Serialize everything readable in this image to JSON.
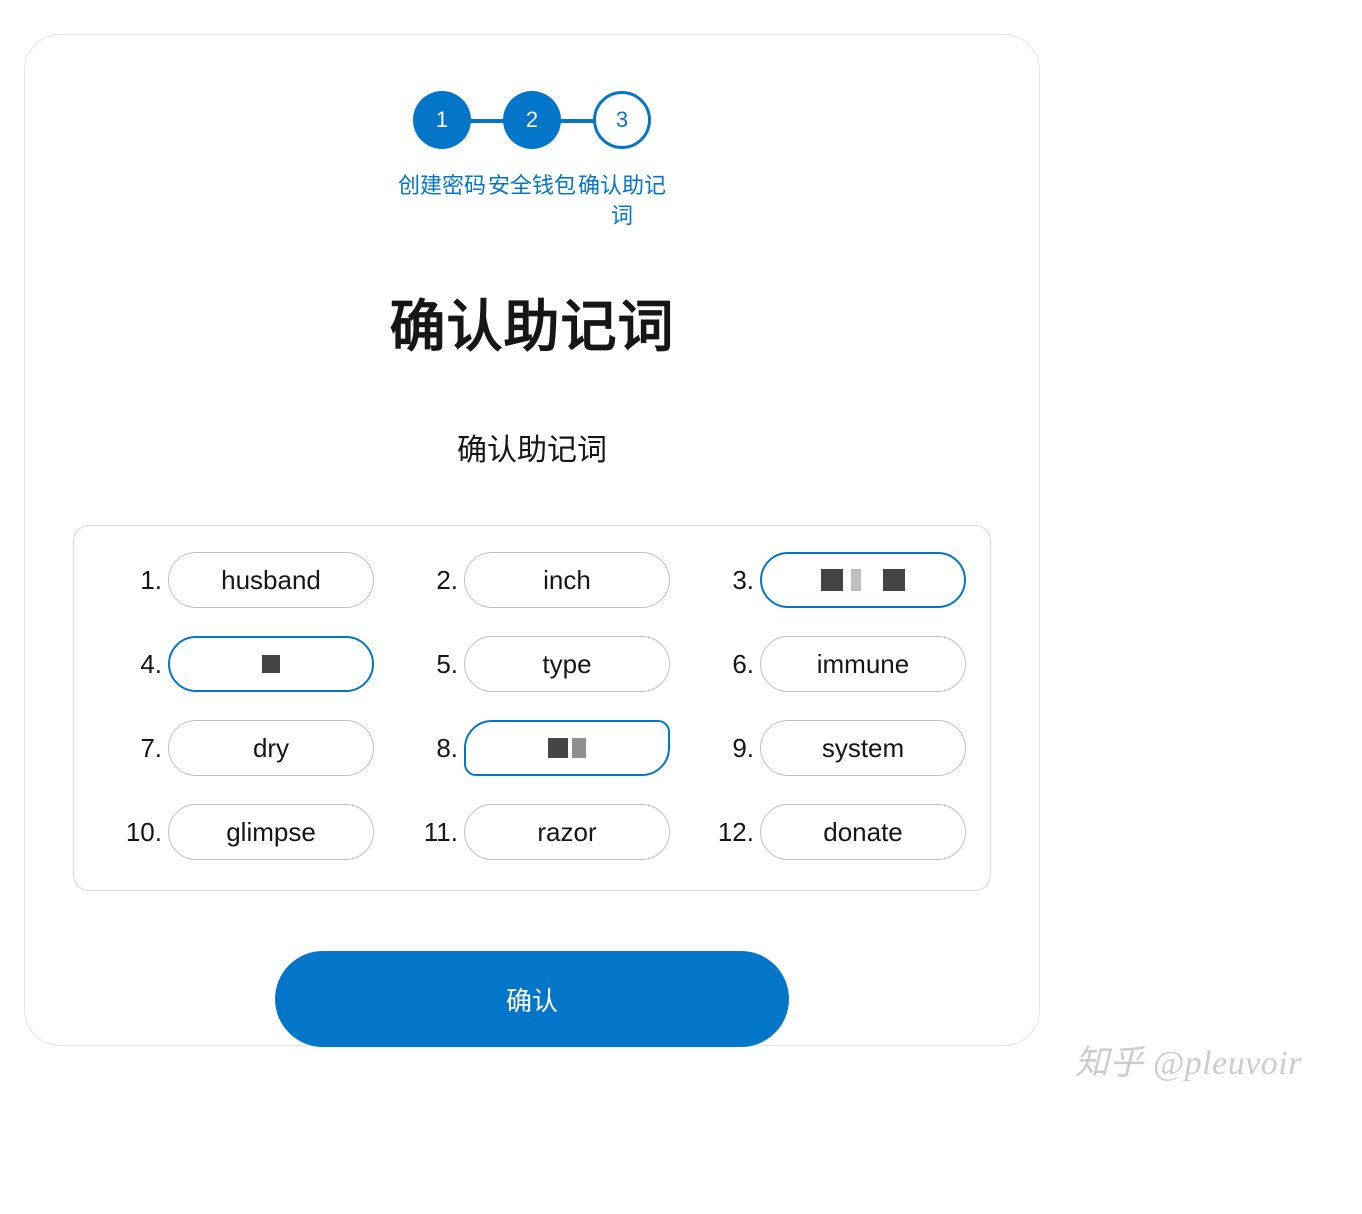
{
  "stepper": {
    "steps": [
      {
        "number": "1",
        "label": "创建密码",
        "filled": true
      },
      {
        "number": "2",
        "label": "安全钱包",
        "filled": true
      },
      {
        "number": "3",
        "label": "确认助记词",
        "filled": false
      }
    ]
  },
  "title": "确认助记词",
  "subtitle": "确认助记词",
  "seed": {
    "words": [
      {
        "n": "1.",
        "text": "husband",
        "style": "normal"
      },
      {
        "n": "2.",
        "text": "inch",
        "style": "normal"
      },
      {
        "n": "3.",
        "text": "",
        "style": "highlight-redact2"
      },
      {
        "n": "4.",
        "text": "",
        "style": "highlight-redact1"
      },
      {
        "n": "5.",
        "text": "type",
        "style": "normal"
      },
      {
        "n": "6.",
        "text": "immune",
        "style": "normal"
      },
      {
        "n": "7.",
        "text": "dry",
        "style": "normal"
      },
      {
        "n": "8.",
        "text": "",
        "style": "scribble-redact"
      },
      {
        "n": "9.",
        "text": "system",
        "style": "normal"
      },
      {
        "n": "10.",
        "text": "glimpse",
        "style": "normal"
      },
      {
        "n": "11.",
        "text": "razor",
        "style": "normal"
      },
      {
        "n": "12.",
        "text": "donate",
        "style": "normal"
      }
    ]
  },
  "confirm_label": "确认",
  "watermark": "知乎 @pleuvoir",
  "colors": {
    "primary": "#0376c9"
  }
}
